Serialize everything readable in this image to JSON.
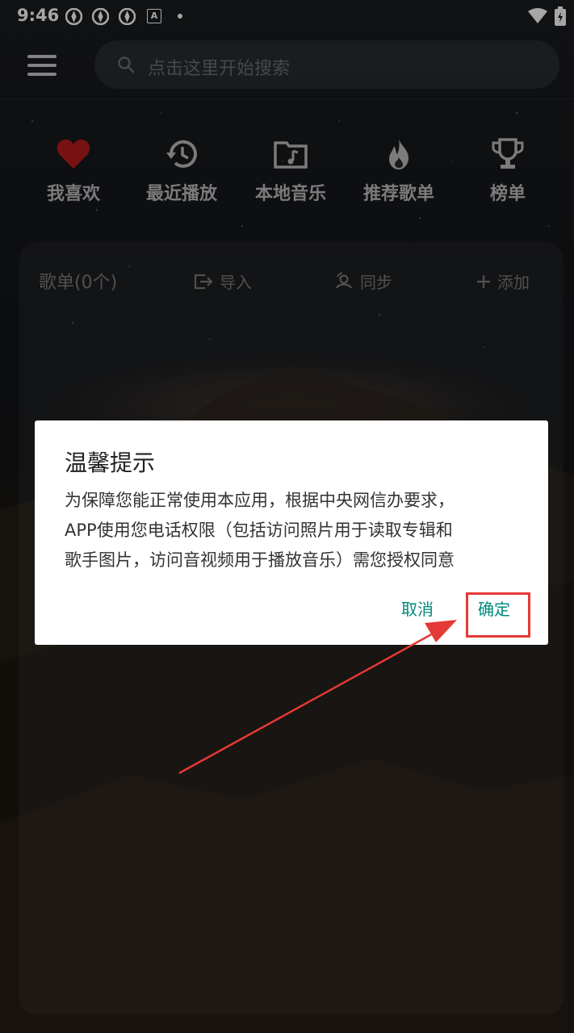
{
  "status_bar": {
    "time": "9:46",
    "badge": "A"
  },
  "search": {
    "placeholder": "点击这里开始搜索"
  },
  "categories": [
    {
      "label": "我喜欢",
      "icon": "heart-icon"
    },
    {
      "label": "最近播放",
      "icon": "history-icon"
    },
    {
      "label": "本地音乐",
      "icon": "music-folder-icon"
    },
    {
      "label": "推荐歌单",
      "icon": "fire-icon"
    },
    {
      "label": "榜单",
      "icon": "trophy-icon"
    }
  ],
  "playlist": {
    "title": "歌单(0个)",
    "import_label": "导入",
    "sync_label": "同步",
    "add_label": "添加"
  },
  "dialog": {
    "title": "温馨提示",
    "line1": "为保障您能正常使用本应用，根据中央网信办要求，",
    "line2": "APP使用您电话权限（包括访问照片用于读取专辑和",
    "line3": "歌手图片，访问音视频用于播放音乐）需您授权同意",
    "cancel_label": "取消",
    "confirm_label": "确定"
  },
  "colors": {
    "accent": "#00897b",
    "heart": "#b71c1c",
    "annotation": "#e53935"
  }
}
